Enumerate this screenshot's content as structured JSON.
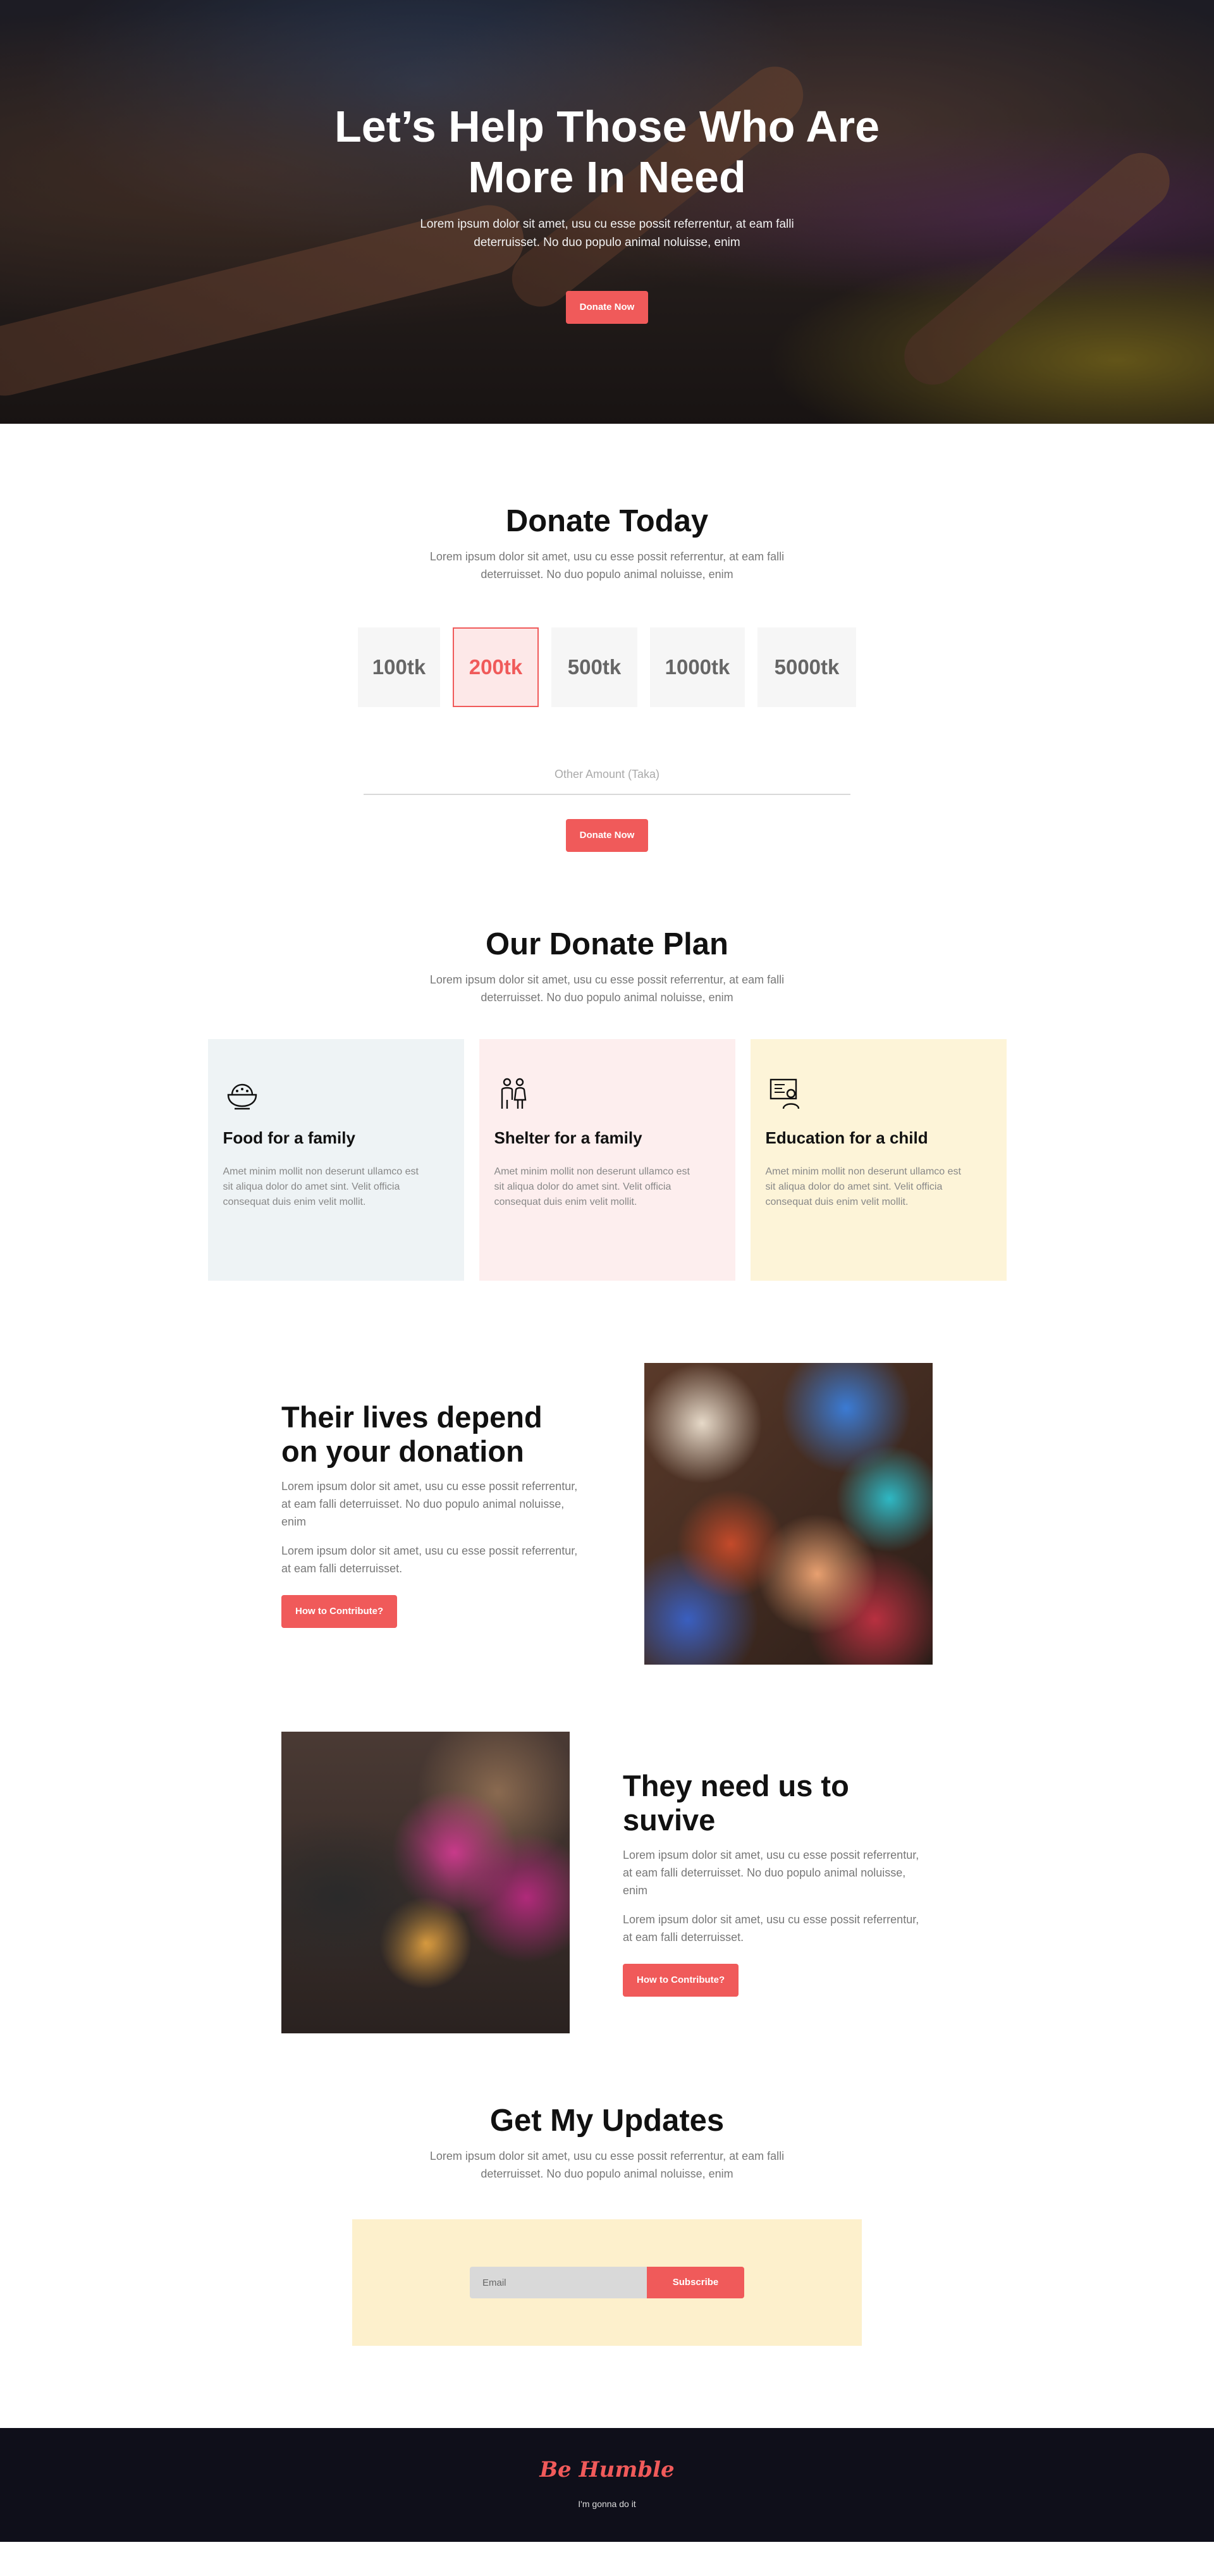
{
  "hero": {
    "title": "Let’s Help Those Who Are More In Need",
    "subtitle": "Lorem ipsum dolor sit amet, usu cu esse possit referrentur, at eam falli deterruisset. No duo populo animal noluisse, enim",
    "button": "Donate Now"
  },
  "donate_today": {
    "title": "Donate Today",
    "subtitle": "Lorem ipsum dolor sit amet, usu cu esse possit referrentur, at eam falli deterruisset. No duo populo animal noluisse, enim",
    "amounts": [
      "100tk",
      "200tk",
      "500tk",
      "1000tk",
      "5000tk"
    ],
    "selected_amount": "200tk",
    "other_placeholder": "Other Amount (Taka)",
    "button": "Donate Now"
  },
  "plan": {
    "title": "Our Donate Plan",
    "subtitle": "Lorem ipsum dolor sit amet, usu cu esse possit referrentur, at eam falli deterruisset. No duo populo animal noluisse, enim",
    "cards": [
      {
        "icon": "food-bowl-icon",
        "title": "Food for a family",
        "text": "Amet minim mollit non deserunt ullamco est sit aliqua dolor do amet sint. Velit officia consequat duis enim velit mollit."
      },
      {
        "icon": "family-icon",
        "title": "Shelter for a family",
        "text": "Amet minim mollit non deserunt ullamco est sit aliqua dolor do amet sint. Velit officia consequat duis enim velit mollit."
      },
      {
        "icon": "education-icon",
        "title": "Education for a child",
        "text": "Amet minim mollit non deserunt ullamco est sit aliqua dolor do amet sint. Velit officia consequat duis enim velit mollit."
      }
    ]
  },
  "feature1": {
    "title": "Their lives depend on your donation",
    "p1": "Lorem ipsum dolor sit amet, usu cu esse possit referrentur, at eam falli deterruisset. No duo populo animal noluisse, enim",
    "p2": "Lorem ipsum dolor sit amet, usu cu esse possit referrentur, at eam falli deterruisset.",
    "button": "How to Contribute?"
  },
  "feature2": {
    "title": "They need us to suvive",
    "p1": "Lorem ipsum dolor sit amet, usu cu esse possit referrentur, at eam falli deterruisset. No duo populo animal noluisse, enim",
    "p2": "Lorem ipsum dolor sit amet, usu cu esse possit referrentur, at eam falli deterruisset.",
    "button": "How to Contribute?"
  },
  "updates": {
    "title": "Get My Updates",
    "subtitle": "Lorem ipsum dolor sit amet, usu cu esse possit referrentur, at eam falli deterruisset. No duo populo animal noluisse, enim",
    "email_placeholder": "Email",
    "button": "Subscribe"
  },
  "footer": {
    "brand": "Be Humble",
    "tagline": "I'm gonna do it"
  },
  "colors": {
    "accent": "#f05a5a",
    "footer_bg": "#0f0f1a",
    "card_food": "#eef3f5",
    "card_shelter": "#fdeeee",
    "card_education": "#fdf4d8",
    "subscribe_bg": "#fdf0cc"
  }
}
